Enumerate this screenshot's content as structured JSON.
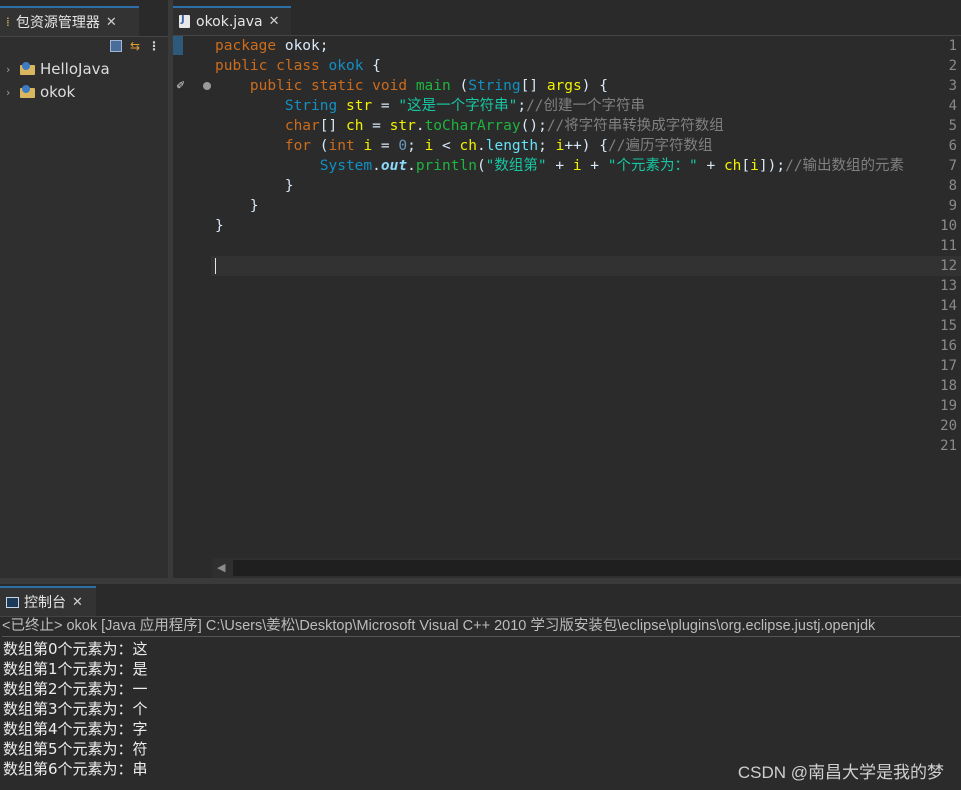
{
  "explorer": {
    "tab_label": "包资源管理器",
    "close_glyph": "✕",
    "projects": [
      {
        "name": "HelloJava"
      },
      {
        "name": "okok"
      }
    ]
  },
  "editor": {
    "tab_label": "okok.java",
    "close_glyph": "✕",
    "line_numbers": [
      "1",
      "2",
      "3",
      "4",
      "5",
      "6",
      "7",
      "8",
      "9",
      "10",
      "11",
      "12",
      "13",
      "14",
      "15",
      "16",
      "17",
      "18",
      "19",
      "20",
      "21"
    ],
    "code": {
      "l1": {
        "kw": "package",
        "rest": " okok;"
      },
      "l2": {
        "kw1": "public",
        "kw2": "class",
        "cls": "okok",
        "rest": " {"
      },
      "l3": {
        "indent": "    ",
        "kw1": "public",
        "kw2": "static",
        "kw3": "void",
        "fn": "main",
        "p1": " (",
        "type": "String",
        "p2": "[] ",
        "var": "args",
        "p3": ") {"
      },
      "l4": {
        "indent": "        ",
        "type": "String",
        "var": "str",
        "eq": " = ",
        "str": "\"这是一个字符串\"",
        "semi": ";",
        "cmt": "//创建一个字符串"
      },
      "l5": {
        "indent": "        ",
        "kw": "char",
        "p1": "[] ",
        "var": "ch",
        "eq": " = ",
        "obj": "str",
        "dot": ".",
        "fn": "toCharArray",
        "p2": "();",
        "cmt": "//将字符串转换成字符数组"
      },
      "l6": {
        "indent": "        ",
        "kw": "for",
        "p1": " (",
        "kw2": "int",
        "sp": " ",
        "var": "i",
        "eq": " = ",
        "num": "0",
        "p2": "; ",
        "v2": "i",
        "lt": " < ",
        "obj": "ch",
        "dot": ".",
        "fld": "length",
        "p3": "; ",
        "v3": "i",
        "p4": "++) {",
        "cmt": "//遍历字符数组"
      },
      "l7": {
        "indent": "            ",
        "cls": "System",
        "dot": ".",
        "sfld": "out",
        "dot2": ".",
        "fn": "println",
        "p1": "(",
        "s1": "\"数组第\"",
        "plus1": " + ",
        "v1": "i",
        "plus2": " + ",
        "s2": "\"个元素为：\"",
        "plus3": " + ",
        "v2": "ch",
        "p2": "[",
        "v3": "i",
        "p3": "]);",
        "cmt": "//输出数组的元素"
      },
      "l8": {
        "text": "        }"
      },
      "l9": {
        "text": "    }"
      },
      "l10": {
        "text": "}"
      }
    }
  },
  "console": {
    "tab_label": "控制台",
    "close_glyph": "✕",
    "header": "<已终止> okok [Java 应用程序] C:\\Users\\姜松\\Desktop\\Microsoft Visual C++ 2010 学习版安装包\\eclipse\\plugins\\org.eclipse.justj.openjdk",
    "output": [
      "数组第0个元素为：这",
      "数组第1个元素为：是",
      "数组第2个元素为：一",
      "数组第3个元素为：个",
      "数组第4个元素为：字",
      "数组第5个元素为：符",
      "数组第6个元素为：串"
    ]
  },
  "watermark": "CSDN @南昌大学是我的梦",
  "colors": {
    "keyword": "#cc6c1d",
    "type": "#1290c3",
    "method": "#1eb540",
    "variable": "#f2f200",
    "string": "#17c6a3",
    "comment": "#808080",
    "active_tab_border": "#2f6fa8"
  }
}
